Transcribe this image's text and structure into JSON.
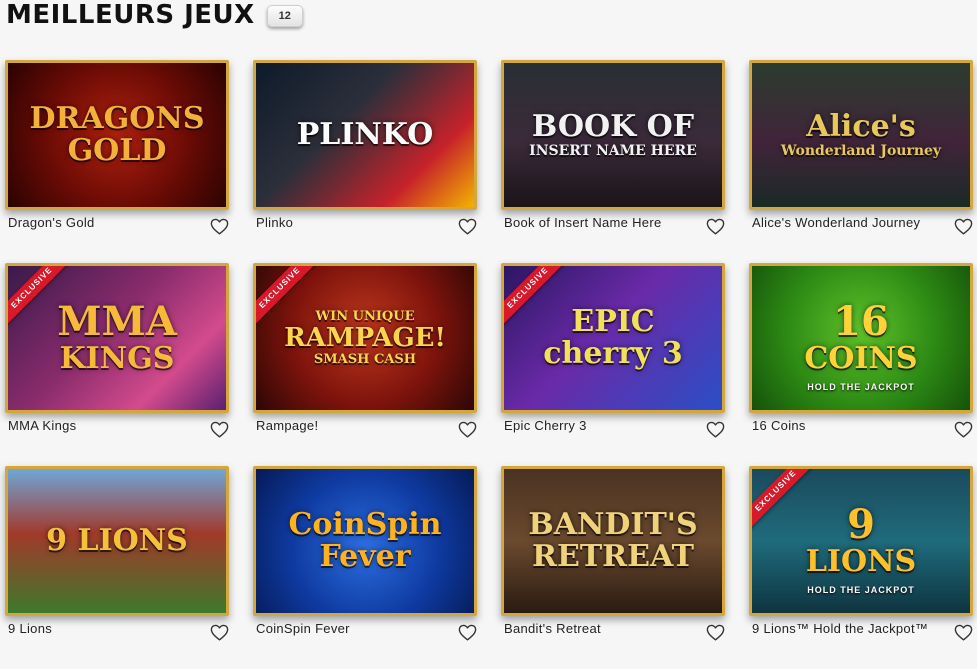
{
  "section": {
    "title": "MEILLEURS JEUX",
    "count": "12"
  },
  "colors": {
    "frame_gold": "#d4a73d",
    "exclusive_red": "#d8192a",
    "page_bg": "#f6f6f6"
  },
  "games": [
    {
      "name": "Dragon's Gold",
      "art_lines": [
        "DRAGONS",
        "GOLD"
      ],
      "art_sub": "",
      "exclusive": false,
      "bg": "radial-gradient(circle at 50% 50%, #b0210f 0%, #6a0b05 55%, #2a0302 100%)",
      "art_color": "#f4b13a"
    },
    {
      "name": "Plinko",
      "art_lines": [
        "PLINKO"
      ],
      "art_sub": "",
      "exclusive": false,
      "bg": "linear-gradient(135deg, #0e1a2a 0%, #2c2f3a 40%, #c7222a 75%, #f3b300 100%)",
      "art_color": "#ffffff"
    },
    {
      "name": "Book of Insert Name Here",
      "art_lines": [
        "BOOK OF",
        "INSERT NAME HERE"
      ],
      "art_sub": "",
      "exclusive": false,
      "bg": "linear-gradient(180deg, #2a2f35 0%, #3b2a3a 55%, #1a1417 100%)",
      "art_color": "#f2f2f2"
    },
    {
      "name": "Alice's Wonderland Journey",
      "art_lines": [
        "Alice's",
        "Wonderland Journey"
      ],
      "art_sub": "",
      "exclusive": false,
      "bg": "linear-gradient(180deg, #2c3c2e 0%, #41243a 55%, #1a2a25 100%)",
      "art_color": "#e8c85a"
    },
    {
      "name": "MMA Kings",
      "art_lines": [
        "MMA",
        "KINGS"
      ],
      "art_sub": "",
      "exclusive": true,
      "ribbon": "Exclusive",
      "bg": "linear-gradient(135deg, #3a1a4a 0%, #8b2c6c 45%, #d34b8d 75%, #5a2070 100%)",
      "art_color": "#f6b93a"
    },
    {
      "name": "Rampage!",
      "art_lines": [
        "WIN UNIQUE",
        "RAMPAGE!",
        "SMASH CASH"
      ],
      "art_sub": "",
      "exclusive": true,
      "ribbon": "Exclusive",
      "bg": "radial-gradient(circle at 50% 45%, #c0381e 0%, #7d130c 55%, #2b0705 100%)",
      "art_color": "#ffd54a"
    },
    {
      "name": "Epic Cherry 3",
      "art_lines": [
        "EPIC",
        "cherry 3"
      ],
      "art_sub": "",
      "exclusive": true,
      "ribbon": "Exclusive",
      "bg": "linear-gradient(135deg, #2b1663 0%, #6a2aa8 45%, #2a4fc6 100%)",
      "art_color": "#f2e05a"
    },
    {
      "name": "16 Coins",
      "art_lines": [
        "16",
        "COINS"
      ],
      "art_sub": "HOLD THE JACKPOT",
      "exclusive": false,
      "bg": "radial-gradient(circle at 50% 45%, #5fc22a 0%, #2d8a14 55%, #15520a 100%)",
      "art_color": "#ffd23a"
    },
    {
      "name": "9 Lions",
      "art_lines": [
        "9 LIONS"
      ],
      "art_sub": "",
      "exclusive": false,
      "bg": "linear-gradient(180deg, #6fa6d8 0%, #a13a2a 45%, #3c7a2c 100%)",
      "art_color": "#f5c13a"
    },
    {
      "name": "CoinSpin Fever",
      "art_lines": [
        "CoinSpin",
        "Fever"
      ],
      "art_sub": "",
      "exclusive": false,
      "bg": "radial-gradient(circle at 50% 55%, #2c6ee0 0%, #0e3aa0 55%, #061a55 100%)",
      "art_color": "#ffb21e"
    },
    {
      "name": "Bandit's Retreat",
      "art_lines": [
        "BANDIT'S",
        "RETREAT"
      ],
      "art_sub": "",
      "exclusive": false,
      "bg": "linear-gradient(180deg, #4a3223 0%, #6b4a2e 50%, #2a1b12 100%)",
      "art_color": "#f0d27a"
    },
    {
      "name": "9 Lions™ Hold the Jackpot™",
      "art_lines": [
        "9",
        "LIONS"
      ],
      "art_sub": "HOLD THE JACKPOT",
      "exclusive": true,
      "ribbon": "Exclusive",
      "bg": "linear-gradient(180deg, #1a4a5c 0%, #1f6b7c 50%, #0f3440 100%)",
      "art_color": "#ffc02a"
    }
  ]
}
